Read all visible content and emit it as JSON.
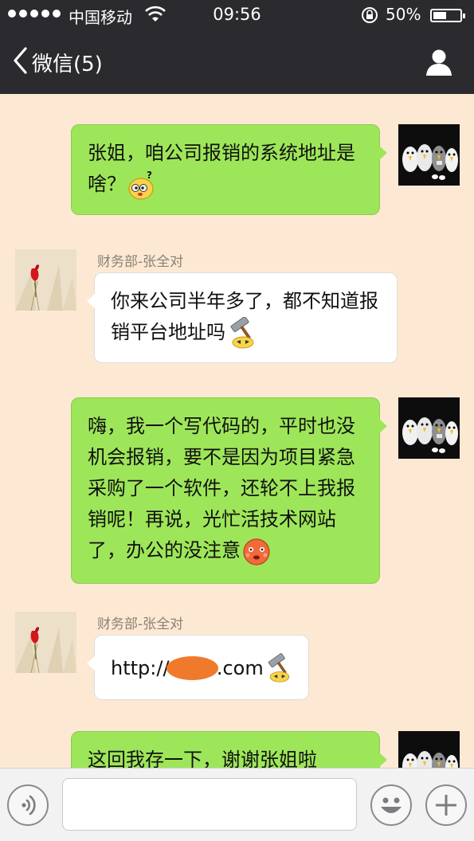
{
  "status_bar": {
    "carrier": "中国移动",
    "time": "09:56",
    "battery": "50%",
    "battery_level": 0.5
  },
  "nav": {
    "back_label": "微信(5)",
    "back_icon": "chevron-left-icon",
    "profile_icon": "person-icon"
  },
  "messages": [
    {
      "direction": "out",
      "text": "张姐，咱公司报销的系统地址是啥？",
      "emoji": "confused-face-emoji"
    },
    {
      "direction": "in",
      "sender": "财务部-张全对",
      "text": "你来公司半年多了，都不知道报销平台地址吗",
      "emoji": "hammer-knock-emoji"
    },
    {
      "direction": "out",
      "text": "嗨，我一个写代码的，平时也没机会报销，要不是因为项目紧急采购了一个软件，还轮不上我报销呢！再说，光忙活技术网站了，办公的没注意",
      "emoji": "blushing-face-emoji"
    },
    {
      "direction": "in",
      "sender": "财务部-张全对",
      "url_prefix": "http://",
      "url_suffix": ".com",
      "emoji": "hammer-knock-emoji"
    },
    {
      "direction": "out",
      "text": "这回我存一下，谢谢张姐啦"
    }
  ],
  "input_bar": {
    "voice_icon": "voice-icon",
    "input_value": "",
    "emoji_icon": "smiley-icon",
    "more_icon": "plus-icon"
  },
  "colors": {
    "chat_background": "#fde9d3",
    "bar_background": "#2b2b2f",
    "outgoing_bubble": "#9ee659",
    "incoming_bubble": "#ffffff",
    "redaction": "#f07a2c"
  }
}
